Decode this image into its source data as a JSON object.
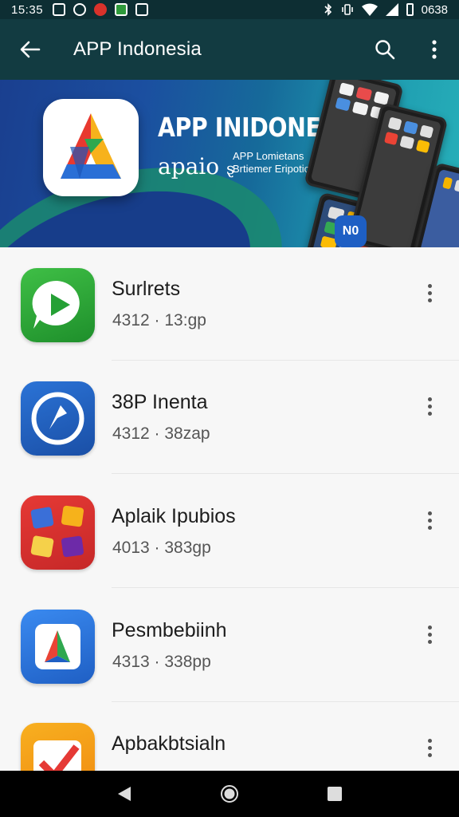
{
  "status_bar": {
    "time": "15:35",
    "right_text": "0638"
  },
  "app_bar": {
    "title": "APP Indonesia"
  },
  "banner": {
    "title": "APP INIDONESIA",
    "subtitle": "apaio",
    "subtitle_symbol": "ȿ",
    "small_text_1": "APP Lomietans",
    "small_text_2": "Brtiemer Eripotio",
    "phone_badge": "N0",
    "slides": 3,
    "active_slide": 1
  },
  "apps": [
    {
      "name": "Surlrets",
      "meta": "4312 · 13:gp",
      "color": "#2aa33a"
    },
    {
      "name": "38P Inenta",
      "meta": "4312 · 38zap",
      "color": "#1f5fbe"
    },
    {
      "name": "Aplaik Ipubios",
      "meta": "4013 · 383gp",
      "color": "#d9312d"
    },
    {
      "name": "Pesmbebiinh",
      "meta": "4313 · 338pp",
      "color": "#2b7be0"
    },
    {
      "name": "Apbakbtsialn",
      "meta": "",
      "color": "#f39a1b"
    }
  ]
}
